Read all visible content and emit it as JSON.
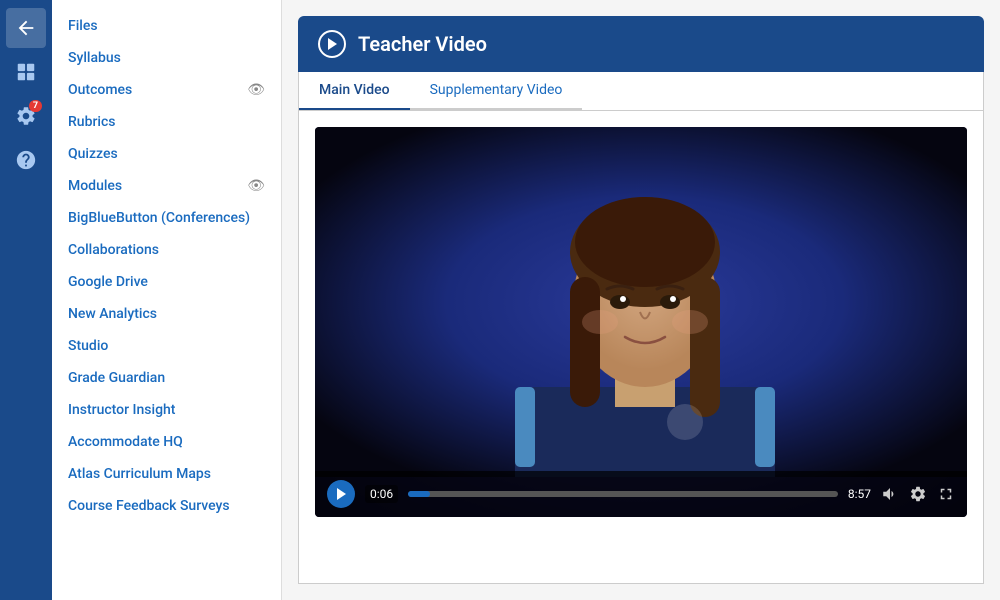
{
  "iconBar": {
    "items": [
      {
        "name": "back-icon",
        "label": "Back",
        "symbol": "↩",
        "active": true
      },
      {
        "name": "course-icon",
        "label": "Course",
        "symbol": "⊞",
        "active": false
      },
      {
        "name": "settings-icon",
        "label": "Settings",
        "symbol": "⚙",
        "badge": "7",
        "active": false
      },
      {
        "name": "help-icon",
        "label": "Help",
        "symbol": "?",
        "active": false
      }
    ]
  },
  "sidebar": {
    "items": [
      {
        "label": "Files",
        "hasEye": false
      },
      {
        "label": "Syllabus",
        "hasEye": false
      },
      {
        "label": "Outcomes",
        "hasEye": true
      },
      {
        "label": "Rubrics",
        "hasEye": false
      },
      {
        "label": "Quizzes",
        "hasEye": false
      },
      {
        "label": "Modules",
        "hasEye": true
      },
      {
        "label": "BigBlueButton (Conferences)",
        "hasEye": false
      },
      {
        "label": "Collaborations",
        "hasEye": false
      },
      {
        "label": "Google Drive",
        "hasEye": false
      },
      {
        "label": "New Analytics",
        "hasEye": false
      },
      {
        "label": "Studio",
        "hasEye": false
      },
      {
        "label": "Grade Guardian",
        "hasEye": false
      },
      {
        "label": "Instructor Insight",
        "hasEye": false
      },
      {
        "label": "Accommodate HQ",
        "hasEye": false
      },
      {
        "label": "Atlas Curriculum Maps",
        "hasEye": false
      },
      {
        "label": "Course Feedback Surveys",
        "hasEye": false
      }
    ]
  },
  "videoSection": {
    "headerTitle": "Teacher Video",
    "tabs": [
      {
        "label": "Main Video",
        "active": true
      },
      {
        "label": "Supplementary Video",
        "active": false
      }
    ],
    "controls": {
      "currentTime": "0:06",
      "totalTime": "8:57",
      "progressPercent": 5
    }
  }
}
